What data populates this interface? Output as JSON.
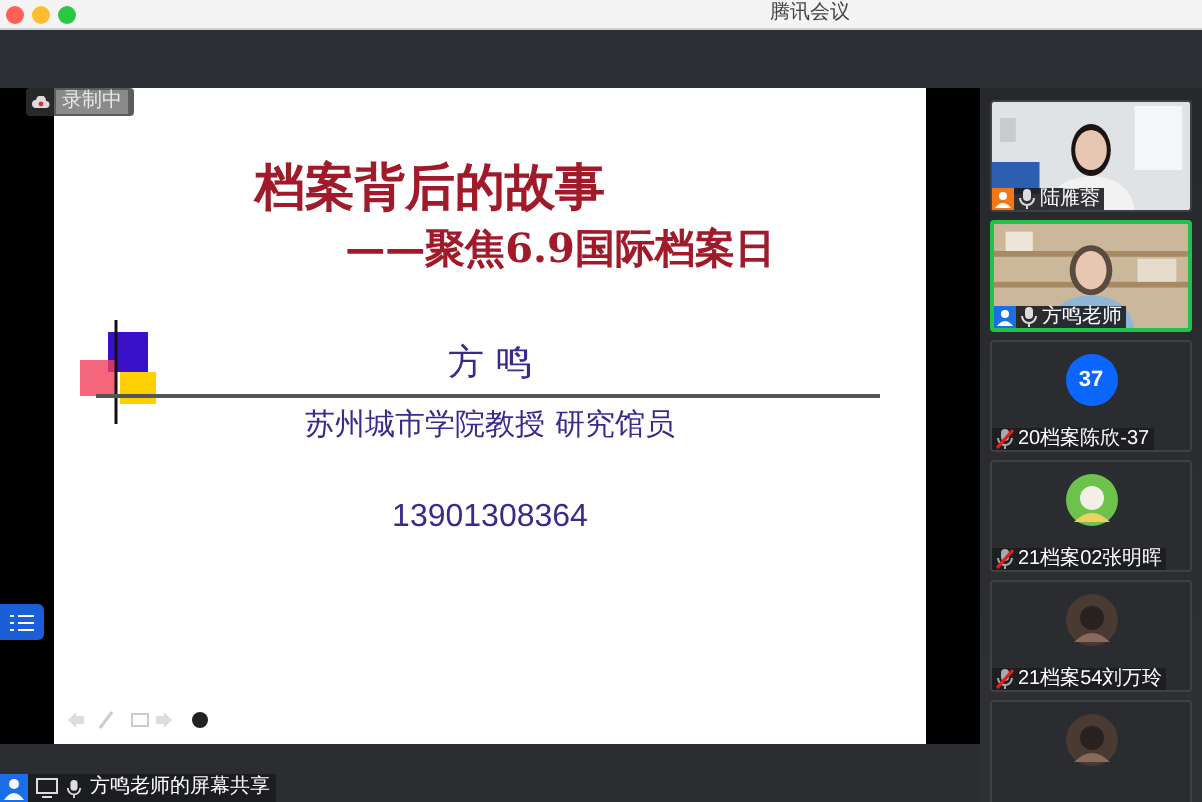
{
  "window": {
    "title": "腾讯会议"
  },
  "recording": {
    "label": "录制中"
  },
  "slide": {
    "title": "档案背后的故事",
    "subtitle": "——聚焦6.9国际档案日",
    "author": "方 鸣",
    "affiliation": "苏州城市学院教授 研究馆员",
    "phone": "13901308364"
  },
  "share_label": "方鸣老师的屏幕共享",
  "participants": [
    {
      "kind": "video",
      "name": "陆雁蓉",
      "selected": false,
      "muted": false,
      "color": "#f07818"
    },
    {
      "kind": "video",
      "name": "方鸣老师",
      "selected": true,
      "muted": false,
      "color": "#1a6fe8"
    },
    {
      "kind": "number",
      "avatar": "37",
      "name": "20档案陈欣-37",
      "selected": false,
      "muted": true
    },
    {
      "kind": "picture",
      "name": "21档案02张明晖",
      "selected": false,
      "muted": true
    },
    {
      "kind": "picture",
      "name": "21档案54刘万玲",
      "selected": false,
      "muted": true
    },
    {
      "kind": "picture",
      "selected": false
    }
  ]
}
